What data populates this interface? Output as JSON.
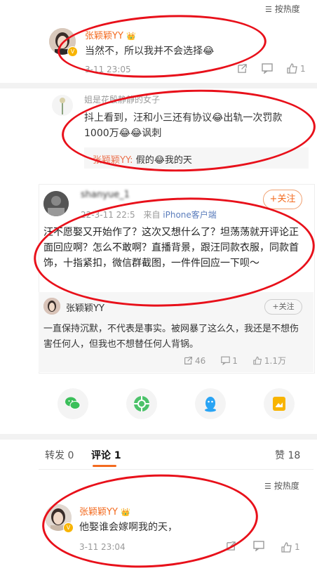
{
  "top_sort": {
    "label": "按热度"
  },
  "c1": {
    "name": "张颖颖YY",
    "text": "当然不，所以我并不会选择",
    "emoji": "😂",
    "time": "3-11 23:05",
    "likes": "1"
  },
  "c2": {
    "name": "姐是花殷静静的女子",
    "text_line1": "抖上看到，汪和小三还有协议",
    "text_line1b": "出轨一次罚款",
    "text_line2a": "1000万",
    "text_line2b": "讽刺",
    "reply_name": "张颖颖YY:",
    "reply_text_a": "假的",
    "reply_text_b": "我的天"
  },
  "post": {
    "name": "shanyue_1",
    "date": "22-3-11 22:5",
    "source_prefix": "来自",
    "source": "iPhone客户端",
    "follow": "+关注",
    "text": "汪不愿娶又开始作了？这次又想什么了？坦荡荡就开评论正面回应啊？怎么不敢啊？直播背景，跟汪同款衣服，同款首饰，十指紧扣，微信群截图，一件件回应一下呗～"
  },
  "quoted": {
    "name": "张颖颖YY",
    "follow": "+关注",
    "text": "一直保持沉默，不代表是事实。被网暴了这么久，我还是不想伤害任何人，但我也不想替任何人背锅。",
    "reposts": "46",
    "comments": "1",
    "likes": "1.1万"
  },
  "tabs": {
    "repost": "转发 0",
    "comment": "评论 1",
    "like": "赞 18"
  },
  "sort2": {
    "label": "按热度"
  },
  "c3": {
    "name": "张颖颖YY",
    "text": "他娶谁会嫁啊我的天，",
    "time": "3-11 23:04",
    "likes": "1"
  },
  "colors": {
    "accent": "#f36b20",
    "blue_link": "#eb7350",
    "annotation_red": "#e8101a",
    "gray_text": "#999999"
  }
}
